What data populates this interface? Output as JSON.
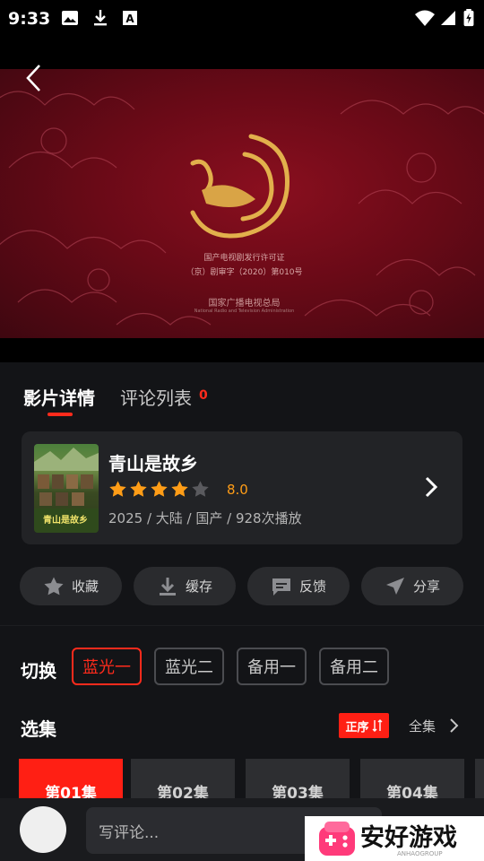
{
  "status_bar": {
    "time": "9:33"
  },
  "video": {
    "license_line1": "国产电视剧发行许可证",
    "license_line2": "（京）剧审字（2020）第010号",
    "authority": "国家广播电视总局",
    "authority_en": "National Radio and Television Administration"
  },
  "tabs": {
    "detail": "影片详情",
    "comments": "评论列表",
    "comment_count": "0"
  },
  "movie": {
    "title": "青山是故乡",
    "rating": "8.0",
    "stars": 4,
    "meta": "2025 / 大陆 / 国产 / 928次播放",
    "poster_text": "青山是故乡"
  },
  "actions": [
    {
      "label": "收藏",
      "icon": "star-icon"
    },
    {
      "label": "缓存",
      "icon": "download-icon"
    },
    {
      "label": "反馈",
      "icon": "message-icon"
    },
    {
      "label": "分享",
      "icon": "send-icon"
    }
  ],
  "source": {
    "label": "切换",
    "options": [
      "蓝光一",
      "蓝光二",
      "备用一",
      "备用二"
    ],
    "selected": "蓝光一"
  },
  "episodes": {
    "label": "选集",
    "order": "正序",
    "all": "全集",
    "items": [
      "第01集",
      "第02集",
      "第03集",
      "第04集"
    ],
    "selected": "第01集"
  },
  "comment": {
    "placeholder": "写评论..."
  },
  "watermark": {
    "text": "安好游戏",
    "sub": "ANHAOGROUP"
  },
  "colors": {
    "accent": "#ff1f14",
    "rating": "#ff9d17",
    "background": "#131417"
  }
}
